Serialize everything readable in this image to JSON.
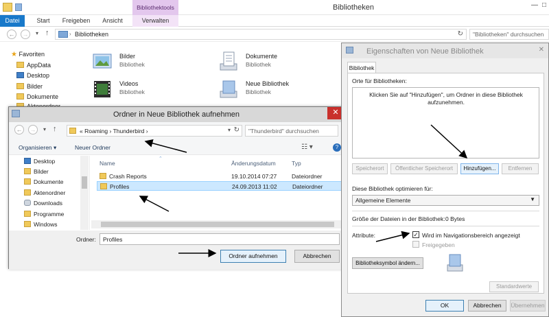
{
  "main_window": {
    "title": "Bibliotheken",
    "context_tab_header": "Bibliothektools",
    "tabs": [
      "Datei",
      "Start",
      "Freigeben",
      "Ansicht",
      "Verwalten"
    ],
    "address": "Bibliotheken",
    "search_placeholder": "\"Bibliotheken\" durchsuchen",
    "nav_favorites": "Favoriten",
    "nav_items": [
      "AppData",
      "Desktop",
      "Bilder",
      "Dokumente",
      "Aktenordner"
    ],
    "libraries": [
      {
        "name": "Bilder",
        "type": "Bibliothek"
      },
      {
        "name": "Videos",
        "type": "Bibliothek"
      },
      {
        "name": "Dokumente",
        "type": "Bibliothek"
      },
      {
        "name": "Neue Bibliothek",
        "type": "Bibliothek"
      }
    ]
  },
  "folder_dialog": {
    "title": "Ordner in Neue Bibliothek aufnehmen",
    "breadcrumb_prefix": "«",
    "breadcrumb": [
      "Roaming",
      "Thunderbird"
    ],
    "search_placeholder": "\"Thunderbird\" durchsuchen",
    "organize_label": "Organisieren",
    "new_folder_label": "Neuer Ordner",
    "tree": [
      "Desktop",
      "Bilder",
      "Dokumente",
      "Aktenordner",
      "Downloads",
      "Programme",
      "Windows"
    ],
    "columns": [
      "Name",
      "Änderungsdatum",
      "Typ"
    ],
    "rows": [
      {
        "name": "Crash Reports",
        "date": "19.10.2014 07:27",
        "type": "Dateiordner"
      },
      {
        "name": "Profiles",
        "date": "24.09.2013 11:02",
        "type": "Dateiordner"
      }
    ],
    "folder_label": "Ordner:",
    "folder_value": "Profiles",
    "include_button": "Ordner aufnehmen",
    "cancel_button": "Abbrechen"
  },
  "properties_dialog": {
    "title": "Eigenschaften von Neue Bibliothek",
    "tab": "Bibliothek",
    "locations_label": "Orte für Bibliotheken:",
    "locations_hint": "Klicken Sie auf \"Hinzufügen\", um Ordner in diese Bibliothek aufzunehmen.",
    "buttons": {
      "save_location": "Speicherort",
      "public_save_location": "Öffentlicher Speicherort",
      "add": "Hinzufügen...",
      "remove": "Entfernen"
    },
    "optimize_label": "Diese Bibliothek optimieren für:",
    "optimize_value": "Allgemeine Elemente",
    "size_label": "Größe der Dateien in der Bibliothek:",
    "size_value": "0 Bytes",
    "attributes_label": "Attribute:",
    "attr_nav": "Wird im Navigationsbereich angezeigt",
    "attr_nav_checked": true,
    "attr_shared": "Freigegeben",
    "attr_shared_checked": false,
    "change_icon_button": "Bibliotheksymbol ändern...",
    "defaults_button": "Standardwerte",
    "ok_button": "OK",
    "cancel_button": "Abbrechen",
    "apply_button": "Übernehmen"
  },
  "colors": {
    "file_tab": "#1979ca",
    "context_tab": "#e3c7ed",
    "close_red": "#c9302c",
    "selection": "#cce8ff"
  }
}
